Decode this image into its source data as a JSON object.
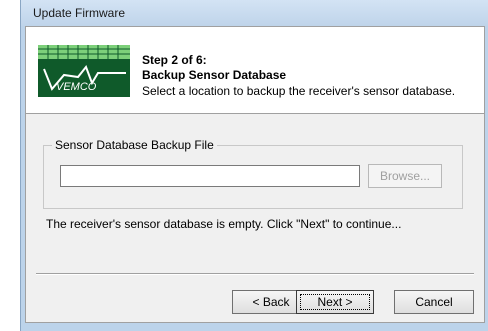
{
  "window": {
    "title": "Update Firmware"
  },
  "header": {
    "logo_text": "VEMCO",
    "step": "Step 2 of 6:",
    "heading": "Backup Sensor Database",
    "description": "Select a location to backup the receiver's sensor database."
  },
  "backup_group": {
    "label": "Sensor Database Backup File",
    "path_value": "",
    "browse_label": "Browse..."
  },
  "status_text": "The receiver's sensor database is empty. Click \"Next\" to continue...",
  "buttons": {
    "back": "< Back",
    "next": "Next >",
    "cancel": "Cancel"
  },
  "colors": {
    "logo_dark_green": "#0f5a2a",
    "logo_light_green": "#7dd07a",
    "title_bar": "#bcd3ea"
  }
}
